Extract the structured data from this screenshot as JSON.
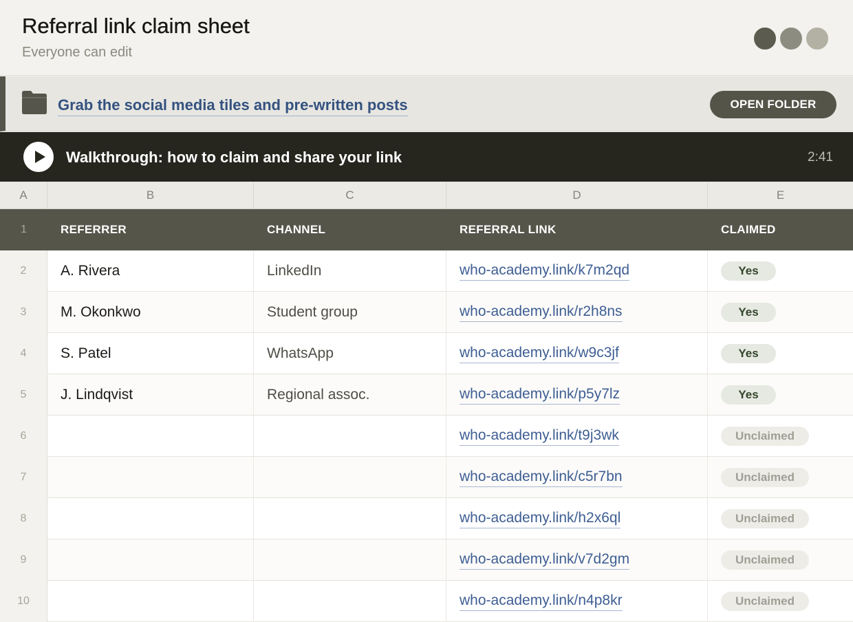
{
  "header": {
    "title": "Referral link claim sheet",
    "subtitle": "Everyone can edit",
    "avatar_colors": [
      "#5b5b4f",
      "#8d8c80",
      "#b3b1a4"
    ]
  },
  "resource": {
    "icon": "folder-icon",
    "link_text": "Grab the social media tiles and pre-written posts",
    "button_label": "OPEN FOLDER"
  },
  "video": {
    "icon": "play-icon",
    "title": "Walkthrough: how to claim and share your link",
    "duration": "2:41"
  },
  "column_letters": [
    "A",
    "B",
    "C",
    "D",
    "E"
  ],
  "table": {
    "header_row_number": "1",
    "headers": [
      "REFERRER",
      "CHANNEL",
      "REFERRAL LINK",
      "CLAIMED"
    ],
    "rows": [
      {
        "num": "2",
        "referrer": "A. Rivera",
        "channel": "LinkedIn",
        "link": "who-academy.link/k7m2qd",
        "claimed": "Yes"
      },
      {
        "num": "3",
        "referrer": "M. Okonkwo",
        "channel": "Student group",
        "link": "who-academy.link/r2h8ns",
        "claimed": "Yes"
      },
      {
        "num": "4",
        "referrer": "S. Patel",
        "channel": "WhatsApp",
        "link": "who-academy.link/w9c3jf",
        "claimed": "Yes"
      },
      {
        "num": "5",
        "referrer": "J. Lindqvist",
        "channel": "Regional assoc.",
        "link": "who-academy.link/p5y7lz",
        "claimed": "Yes"
      },
      {
        "num": "6",
        "referrer": "",
        "channel": "",
        "link": "who-academy.link/t9j3wk",
        "claimed": "Unclaimed"
      },
      {
        "num": "7",
        "referrer": "",
        "channel": "",
        "link": "who-academy.link/c5r7bn",
        "claimed": "Unclaimed"
      },
      {
        "num": "8",
        "referrer": "",
        "channel": "",
        "link": "who-academy.link/h2x6ql",
        "claimed": "Unclaimed"
      },
      {
        "num": "9",
        "referrer": "",
        "channel": "",
        "link": "who-academy.link/v7d2gm",
        "claimed": "Unclaimed"
      },
      {
        "num": "10",
        "referrer": "",
        "channel": "",
        "link": "who-academy.link/n4p8kr",
        "claimed": "Unclaimed"
      }
    ]
  },
  "colors": {
    "accent_dark": "#55554a",
    "link": "#3e5e93",
    "video_bar": "#26261f"
  }
}
